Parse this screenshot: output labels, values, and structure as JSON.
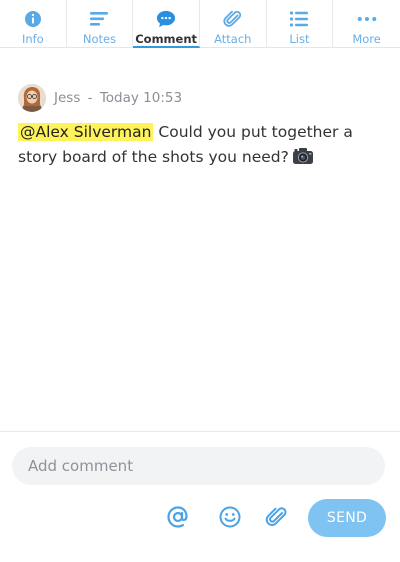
{
  "tabs": [
    {
      "label": "Info",
      "icon": "info-icon"
    },
    {
      "label": "Notes",
      "icon": "notes-icon"
    },
    {
      "label": "Comment",
      "icon": "comment-bubble-icon"
    },
    {
      "label": "Attach",
      "icon": "paperclip-icon"
    },
    {
      "label": "List",
      "icon": "list-icon"
    },
    {
      "label": "More",
      "icon": "more-dots-icon"
    }
  ],
  "active_tab": "Comment",
  "comment": {
    "author": "Jess",
    "separator": "-",
    "timestamp": "Today 10:53",
    "mention": "@Alex Silverman",
    "text": " Could you put together a story board of the shots you need?",
    "emoji": "camera-icon"
  },
  "composer": {
    "placeholder": "Add comment",
    "mention_icon": "at-icon",
    "emoji_icon": "smiley-icon",
    "attach_icon": "paperclip-icon",
    "send_label": "SEND"
  },
  "colors": {
    "accent": "#3399e0",
    "tab_icon": "#5aaae6",
    "mention_highlight": "#fff35a",
    "send_button": "#7ec3f2",
    "input_bg": "#f2f3f5"
  }
}
